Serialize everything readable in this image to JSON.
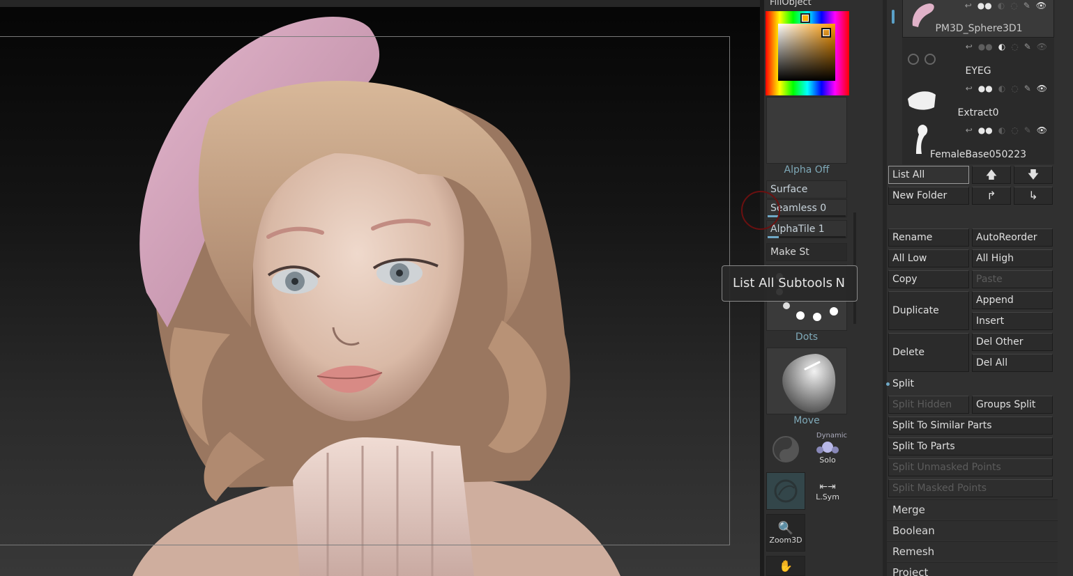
{
  "colors": {
    "accent": "#6fa8c6",
    "panel": "#303030",
    "button": "#2b2b2b",
    "label_blue": "#7fa9b8",
    "beret": "#d8a6c0",
    "hair": "#c8a585",
    "skin": "#e0c5b4"
  },
  "material_panel": {
    "fill_label": "FillObject",
    "alpha_label": "Alpha Off",
    "surface_label": "Surface",
    "seamless_label": "Seamless 0",
    "seamless_value": 0,
    "alphatile_label": "AlphaTile 1",
    "alphatile_value": 1,
    "make_st_label": "Make St",
    "stroke_label": "Dots",
    "brush_label": "Move",
    "dynamic_label": "Dynamic",
    "solo_label": "Solo",
    "lsym_label": "L.Sym",
    "zoom_label": "Zoom3D"
  },
  "tooltip": {
    "text": "List All Subtools",
    "shortcut": "N"
  },
  "subtools": {
    "items": [
      {
        "name": "PM3D_Sphere3D1",
        "icon": "beret-thumbnail",
        "selected": true
      },
      {
        "name": "EYEG",
        "icon": "eye-spheres-thumbnail",
        "selected": false
      },
      {
        "name": "Extract0",
        "icon": "ruffle-collar-thumbnail",
        "selected": false
      },
      {
        "name": "FemaleBase050223",
        "icon": "female-body-thumbnail",
        "selected": false
      }
    ],
    "list_all": "List All",
    "new_folder": "New Folder",
    "rename": "Rename",
    "auto_reorder": "AutoReorder",
    "all_low": "All Low",
    "all_high": "All High",
    "copy": "Copy",
    "paste": "Paste",
    "duplicate": "Duplicate",
    "append": "Append",
    "insert": "Insert",
    "delete": "Delete",
    "del_other": "Del Other",
    "del_all": "Del All"
  },
  "split": {
    "title": "Split",
    "split_hidden": "Split Hidden",
    "groups_split": "Groups Split",
    "split_similar": "Split To Similar Parts",
    "split_parts": "Split To Parts",
    "split_unmasked": "Split Unmasked Points",
    "split_masked": "Split Masked Points"
  },
  "sections": {
    "merge": "Merge",
    "boolean": "Boolean",
    "remesh": "Remesh",
    "project": "Project"
  }
}
